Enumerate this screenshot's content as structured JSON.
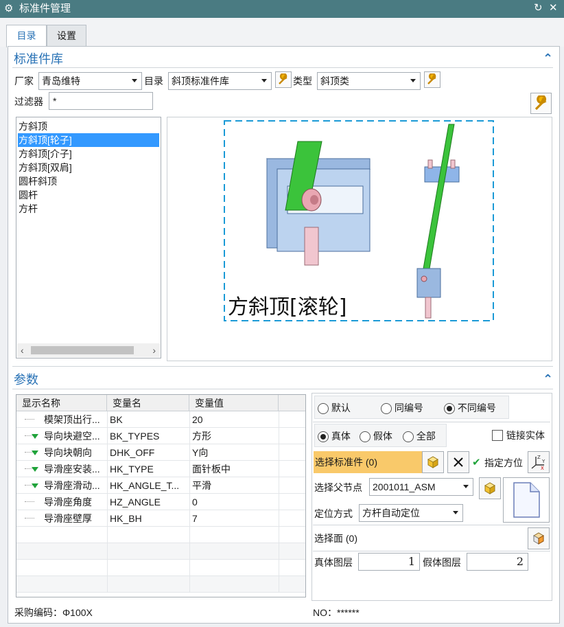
{
  "window": {
    "title": "标准件管理",
    "settings_icon": "gear-icon",
    "refresh_icon": "refresh-icon",
    "close_icon": "close-icon"
  },
  "tabs": [
    {
      "label": "目录",
      "active": true
    },
    {
      "label": "设置",
      "active": false
    }
  ],
  "library": {
    "title": "标准件库",
    "vendor_label": "厂家",
    "vendor_value": "青岛维特",
    "catalog_label": "目录",
    "catalog_value": "斜顶标准件库",
    "type_label": "类型",
    "type_value": "斜顶类",
    "filter_label": "过滤器",
    "filter_value": "*",
    "items": [
      "方斜顶",
      "方斜顶[轮子]",
      "方斜顶[介子]",
      "方斜顶[双肩]",
      "圆杆斜顶",
      "圆杆",
      "方杆"
    ],
    "selected_index": 1,
    "preview_caption": "方斜顶[滚轮]"
  },
  "params": {
    "title": "参数",
    "columns": [
      "显示名称",
      "变量名",
      "变量值"
    ],
    "rows": [
      {
        "name": "模架顶出行...",
        "var": "BK",
        "value": "20",
        "expand": false
      },
      {
        "name": "导向块避空...",
        "var": "BK_TYPES",
        "value": "方形",
        "expand": true
      },
      {
        "name": "导向块朝向",
        "var": "DHK_OFF",
        "value": "Y向",
        "expand": true
      },
      {
        "name": "导滑座安装...",
        "var": "HK_TYPE",
        "value": "面针板中",
        "expand": true
      },
      {
        "name": "导滑座滑动...",
        "var": "HK_ANGLE_T...",
        "value": "平滑",
        "expand": true
      },
      {
        "name": "导滑座角度",
        "var": "HZ_ANGLE",
        "value": "0",
        "expand": false
      },
      {
        "name": "导滑座壁厚",
        "var": "HK_BH",
        "value": "7",
        "expand": false
      }
    ]
  },
  "options": {
    "numbering": [
      "默认",
      "同编号",
      "不同编号"
    ],
    "numbering_selected": 2,
    "body": [
      "真体",
      "假体",
      "全部"
    ],
    "body_selected": 0,
    "link_solid_label": "链接实体",
    "select_std_label": "选择标准件 (0)",
    "specify_orient_label": "指定方位",
    "parent_label": "选择父节点",
    "parent_value": "2001011_ASM",
    "position_label": "定位方式",
    "position_value": "方杆自动定位",
    "face_label": "选择面 (0)",
    "solid_layer_label": "真体图层",
    "solid_layer_value": "1",
    "dummy_layer_label": "假体图层",
    "dummy_layer_value": "2"
  },
  "footer": {
    "purchase_code": "采购编码：Φ100X",
    "no": "NO：******"
  }
}
